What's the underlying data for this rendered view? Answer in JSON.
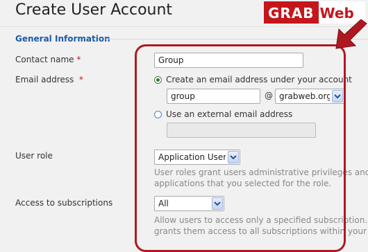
{
  "page": {
    "title": "Create User Account"
  },
  "logo": {
    "part1": "GRAB",
    "part2": "Web"
  },
  "section": {
    "title": "General Information"
  },
  "fields": {
    "contact_name": {
      "label": "Contact name",
      "required": "*",
      "value": "Group"
    },
    "email": {
      "label": "Email address",
      "required": "*",
      "option_create": "Create an email address under your account",
      "local_part": "group",
      "at": "@",
      "domain": "grabweb.org",
      "option_external": "Use an external email address",
      "external_value": ""
    },
    "user_role": {
      "label": "User role",
      "selected": "Application User",
      "hint_line1": "User roles grant users administrative privileges and",
      "hint_line2": "applications that you selected for the role."
    },
    "subscriptions": {
      "label": "Access to subscriptions",
      "selected": "All",
      "hint_line1": "Allow users to access only a specified subscription. T",
      "hint_line2": "grants them access to all subscriptions within your h"
    }
  },
  "colors": {
    "highlight": "#b01820",
    "section_title": "#1d5aa8",
    "brand": "#c4161c"
  },
  "icons": {
    "select_arrow": "chevron-down-icon",
    "pointer": "red-arrow-icon"
  }
}
